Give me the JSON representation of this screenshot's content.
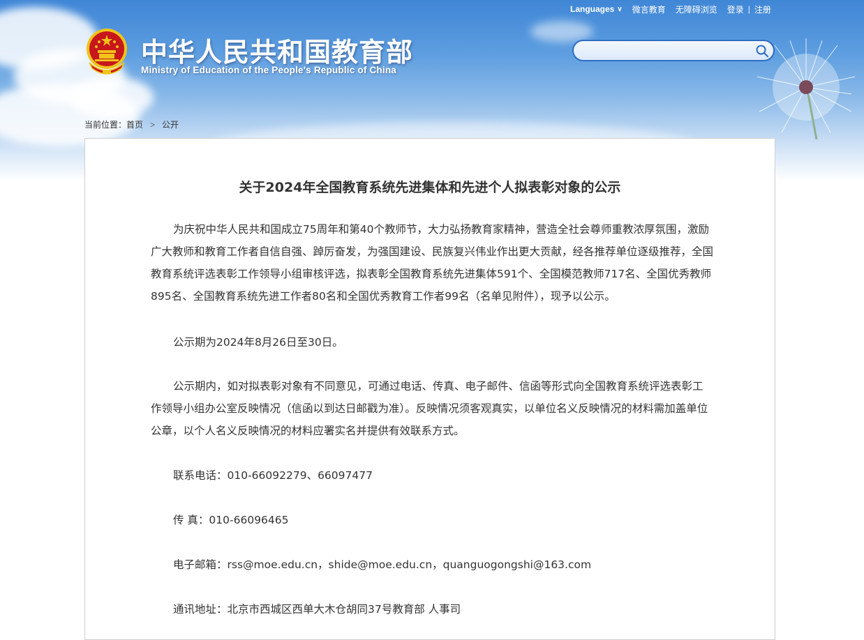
{
  "header": {
    "top_links": {
      "languages": "Languages",
      "weiyan": "微言教育",
      "accessibility": "无障碍浏览",
      "login": "登录",
      "separator": "|",
      "register": "注册"
    },
    "site_title": "中华人民共和国教育部",
    "site_subtitle": "Ministry of Education of the People's Republic of China",
    "search": {
      "value": "",
      "placeholder": ""
    }
  },
  "breadcrumb": {
    "prefix": "当前位置：",
    "home": "首页",
    "current": "公开"
  },
  "article": {
    "title": "关于2024年全国教育系统先进集体和先进个人拟表彰对象的公示",
    "paragraphs": [
      "为庆祝中华人民共和国成立75周年和第40个教师节，大力弘扬教育家精神，营造全社会尊师重教浓厚氛围，激励广大教师和教育工作者自信自强、踔厉奋发，为强国建设、民族复兴伟业作出更大贡献，经各推荐单位逐级推荐，全国教育系统评选表彰工作领导小组审核评选，拟表彰全国教育系统先进集体591个、全国模范教师717名、全国优秀教师895名、全国教育系统先进工作者80名和全国优秀教育工作者99名（名单见附件），现予以公示。",
      "公示期为2024年8月26日至30日。",
      "公示期内，如对拟表彰对象有不同意见，可通过电话、传真、电子邮件、信函等形式向全国教育系统评选表彰工作领导小组办公室反映情况（信函以到达日邮戳为准）。反映情况须客观真实，以单位名义反映情况的材料需加盖单位公章，以个人名义反映情况的材料应署实名并提供有效联系方式。",
      "联系电话：010-66092279、66097477",
      "传 真：010-66096465",
      "电子邮箱：rss@moe.edu.cn，shide@moe.edu.cn，quanguogongshi@163.com",
      "通讯地址：北京市西城区西单大木仓胡同37号教育部 人事司"
    ]
  },
  "icons": {
    "emblem": "national-emblem-icon",
    "search": "search-icon",
    "chevron": "chevron-down-icon",
    "breadcrumb_arrow": "chevron-right-icon"
  },
  "colors": {
    "sky_top": "#3f86d6",
    "search_border": "#2f6ec2",
    "text": "#333333",
    "emblem_red": "#c8161d",
    "emblem_gold": "#f0c419"
  }
}
